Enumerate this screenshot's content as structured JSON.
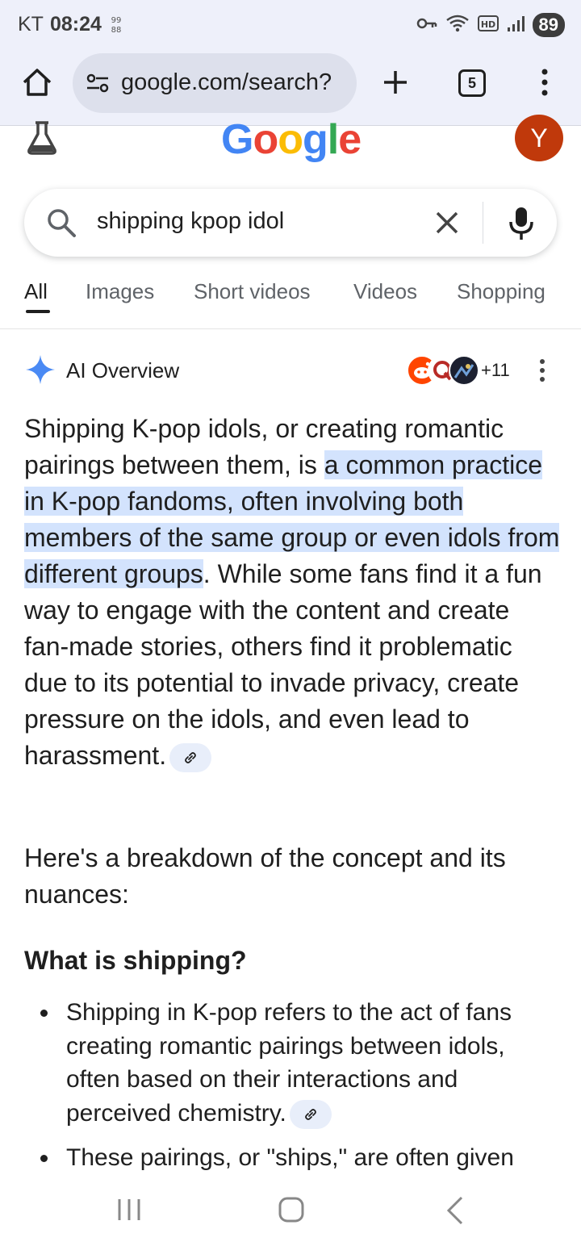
{
  "status_bar": {
    "carrier": "KT",
    "time": "08:24",
    "battery": "89"
  },
  "browser": {
    "url": "google.com/search?",
    "tab_count": "5"
  },
  "google": {
    "logo_text": "Google",
    "avatar_letter": "Y"
  },
  "search": {
    "query": "shipping kpop idol"
  },
  "tabs": [
    {
      "label": "All",
      "active": true
    },
    {
      "label": "Images"
    },
    {
      "label": "Short videos"
    },
    {
      "label": "Videos"
    },
    {
      "label": "Shopping"
    }
  ],
  "ai_overview": {
    "title": "AI Overview",
    "source_count": "+11",
    "intro_before": "Shipping K-pop idols, or creating romantic pairings between them, is ",
    "intro_highlight": "a common practice in K-pop fandoms, often involving both members of the same group or even idols from different groups",
    "intro_after": ". While some fans find it a fun way to engage with the content and create fan-made stories, others find it problematic due to its potential to invade privacy, create pressure on the idols, and even lead to harassment.",
    "breakdown": "Here's a breakdown of the concept and its nuances:",
    "section_heading": "What is shipping?",
    "bullets": [
      "Shipping in K-pop refers to the act of fans creating romantic pairings between idols, often based on their interactions and perceived chemistry.",
      "These pairings, or \"ships,\" are often given"
    ]
  },
  "colors": {
    "highlight": "#d3e3fd",
    "avatar_bg": "#c0390b",
    "toolbar_bg": "#eef0fa"
  }
}
